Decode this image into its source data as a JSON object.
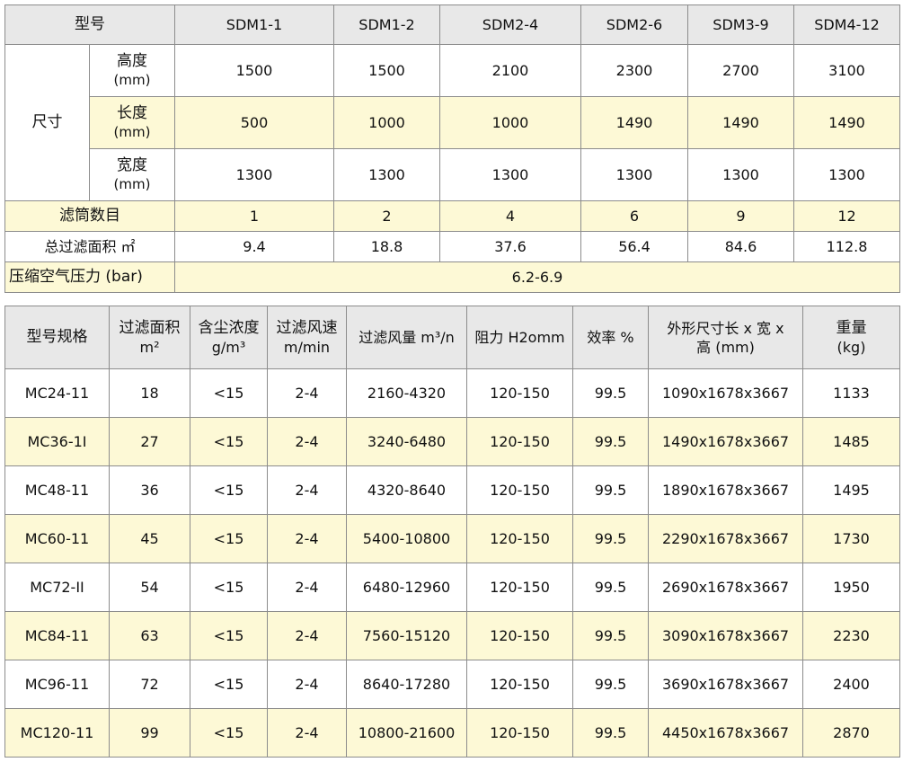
{
  "table1": {
    "header": {
      "label": "型号",
      "models": [
        "SDM1-1",
        "SDM1-2",
        "SDM2-4",
        "SDM2-6",
        "SDM3-9",
        "SDM4-12"
      ]
    },
    "size_label": "尺寸",
    "dims": [
      {
        "name": "高度",
        "unit": "(mm)",
        "values": [
          "1500",
          "1500",
          "2100",
          "2300",
          "2700",
          "3100"
        ]
      },
      {
        "name": "长度",
        "unit": "(mm)",
        "values": [
          "500",
          "1000",
          "1000",
          "1490",
          "1490",
          "1490"
        ]
      },
      {
        "name": "宽度",
        "unit": "(mm)",
        "values": [
          "1300",
          "1300",
          "1300",
          "1300",
          "1300",
          "1300"
        ]
      }
    ],
    "filters": {
      "label": "滤筒数目",
      "values": [
        "1",
        "2",
        "4",
        "6",
        "9",
        "12"
      ]
    },
    "area": {
      "label": "总过滤面积 ㎡",
      "values": [
        "9.4",
        "18.8",
        "37.6",
        "56.4",
        "84.6",
        "112.8"
      ]
    },
    "pressure": {
      "label": "压缩空气压力 (bar)",
      "value": "6.2-6.9"
    }
  },
  "table2": {
    "headers": [
      {
        "line1": "型号规格",
        "line2": ""
      },
      {
        "line1": "过滤面积",
        "line2": "m²"
      },
      {
        "line1": "含尘浓度",
        "line2": "g/m³"
      },
      {
        "line1": "过滤风速",
        "line2": "m/min"
      },
      {
        "line1": "过滤风量 m³/n",
        "line2": ""
      },
      {
        "line1": "阻力 H2omm",
        "line2": ""
      },
      {
        "line1": "效率 %",
        "line2": ""
      },
      {
        "line1": "外形尺寸长 x 宽 x",
        "line2": "高 (mm)"
      },
      {
        "line1": "重量",
        "line2": "(kg)"
      }
    ],
    "rows": [
      [
        "MC24-11",
        "18",
        "<15",
        "2-4",
        "2160-4320",
        "120-150",
        "99.5",
        "1090x1678x3667",
        "1133"
      ],
      [
        "MC36-1I",
        "27",
        "<15",
        "2-4",
        "3240-6480",
        "120-150",
        "99.5",
        "1490x1678x3667",
        "1485"
      ],
      [
        "MC48-11",
        "36",
        "<15",
        "2-4",
        "4320-8640",
        "120-150",
        "99.5",
        "1890x1678x3667",
        "1495"
      ],
      [
        "MC60-11",
        "45",
        "<15",
        "2-4",
        "5400-10800",
        "120-150",
        "99.5",
        "2290x1678x3667",
        "1730"
      ],
      [
        "MC72-II",
        "54",
        "<15",
        "2-4",
        "6480-12960",
        "120-150",
        "99.5",
        "2690x1678x3667",
        "1950"
      ],
      [
        "MC84-11",
        "63",
        "<15",
        "2-4",
        "7560-15120",
        "120-150",
        "99.5",
        "3090x1678x3667",
        "2230"
      ],
      [
        "MC96-11",
        "72",
        "<15",
        "2-4",
        "8640-17280",
        "120-150",
        "99.5",
        "3690x1678x3667",
        "2400"
      ],
      [
        "MC120-11",
        "99",
        "<15",
        "2-4",
        "10800-21600",
        "120-150",
        "99.5",
        "4450x1678x3667",
        "2870"
      ]
    ]
  }
}
